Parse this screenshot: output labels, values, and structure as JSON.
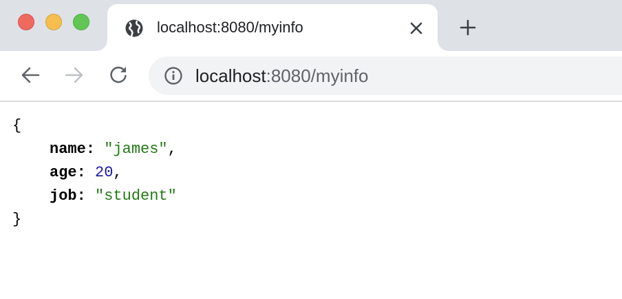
{
  "window": {
    "traffic_lights": [
      "close",
      "minimize",
      "zoom"
    ]
  },
  "tab": {
    "title": "localhost:8080/myinfo",
    "icon": "globe-icon",
    "close_icon": "close-icon"
  },
  "new_tab": {
    "icon": "plus-icon"
  },
  "toolbar": {
    "back_icon": "arrow-left-icon",
    "forward_icon": "arrow-right-icon",
    "reload_icon": "reload-icon",
    "info_icon": "info-icon",
    "url_host": "localhost",
    "url_rest": ":8080/myinfo"
  },
  "json_view": {
    "open_brace": "{",
    "close_brace": "}",
    "entries": [
      {
        "key": "name",
        "value": "\"james\"",
        "value_type": "string",
        "trailing": ","
      },
      {
        "key": "age",
        "value": "20",
        "value_type": "number",
        "trailing": ","
      },
      {
        "key": "job",
        "value": "\"student\"",
        "value_type": "string",
        "trailing": ""
      }
    ]
  },
  "colors": {
    "string": "#237a14",
    "number": "#1a1aa6",
    "tabstrip": "#dee1e6",
    "omnibox": "#f1f3f4"
  }
}
